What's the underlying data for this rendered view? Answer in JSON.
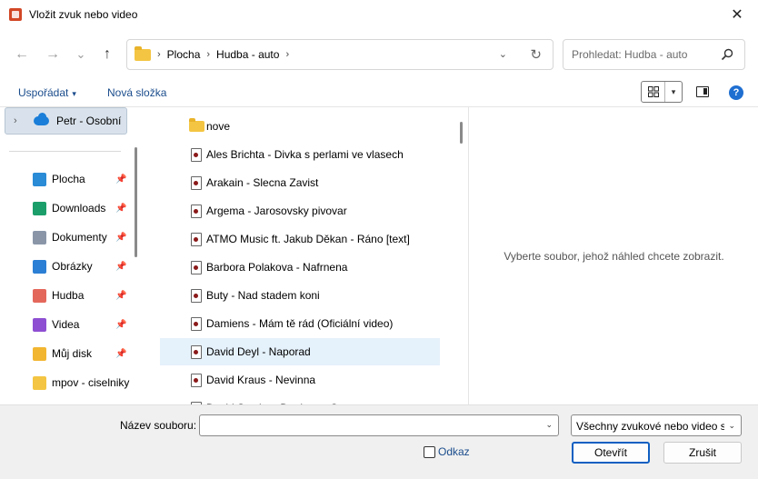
{
  "window": {
    "title": "Vložit zvuk nebo video",
    "close_glyph": "✕"
  },
  "nav": {
    "back_glyph": "←",
    "forward_glyph": "→",
    "recent_glyph": "⌄",
    "up_glyph": "↑"
  },
  "address": {
    "sep": "›",
    "crumbs": [
      "Plocha",
      "Hudba - auto"
    ],
    "dropdown_glyph": "⌄",
    "refresh_glyph": "↻"
  },
  "search": {
    "placeholder": "Prohledat: Hudba - auto"
  },
  "toolbar": {
    "organize_label": "Uspořádat",
    "new_folder_label": "Nová složka",
    "caret": "▾",
    "help_glyph": "?"
  },
  "sidebar": {
    "onedrive": {
      "label": "Petr - Osobní",
      "chevron": "›"
    },
    "pin_glyph": "📌",
    "items": [
      {
        "label": "Plocha",
        "icon": "desktop-icon",
        "color": "#2a8bd6",
        "pinned": true
      },
      {
        "label": "Downloads",
        "icon": "download-icon",
        "color": "#1c9e6a",
        "pinned": true
      },
      {
        "label": "Dokumenty",
        "icon": "documents-icon",
        "color": "#8a96a8",
        "pinned": true
      },
      {
        "label": "Obrázky",
        "icon": "pictures-icon",
        "color": "#2b7fd4",
        "pinned": true
      },
      {
        "label": "Hudba",
        "icon": "music-icon",
        "color": "#e4675c",
        "pinned": true
      },
      {
        "label": "Videa",
        "icon": "videos-icon",
        "color": "#8e4fd2",
        "pinned": true
      },
      {
        "label": "Můj disk",
        "icon": "google-drive-icon",
        "color": "#f2b631",
        "pinned": true
      },
      {
        "label": "mpov - ciselniky",
        "icon": "folder-icon",
        "color": "#f4c542",
        "pinned": false
      }
    ]
  },
  "files": [
    {
      "name": "nove",
      "type": "folder"
    },
    {
      "name": "Ales Brichta - Divka s perlami ve vlasech",
      "type": "media"
    },
    {
      "name": "Arakain - Slecna Zavist",
      "type": "media"
    },
    {
      "name": "Argema - Jarosovsky pivovar",
      "type": "media"
    },
    {
      "name": "ATMO Music ft. Jakub Děkan - Ráno [text]",
      "type": "media"
    },
    {
      "name": "Barbora Polakova - Nafrnena",
      "type": "media"
    },
    {
      "name": "Buty - Nad stadem koni",
      "type": "media"
    },
    {
      "name": "Damiens - Mám tě rád (Oficiální video)",
      "type": "media"
    },
    {
      "name": "David Deyl - Naporad",
      "type": "media",
      "selected": true
    },
    {
      "name": "David Kraus - Nevinna",
      "type": "media"
    },
    {
      "name": "David Stypka - Dopis pro Ostravu",
      "type": "media"
    }
  ],
  "preview": {
    "message": "Vyberte soubor, jehož náhled chcete zobrazit."
  },
  "footer": {
    "filename_label": "Název souboru:",
    "filename_value": "",
    "filetype_value": "Všechny zvukové nebo video soubory",
    "link_label": "Odkaz",
    "open_label": "Otevřít",
    "cancel_label": "Zrušit",
    "caret": "⌄"
  }
}
